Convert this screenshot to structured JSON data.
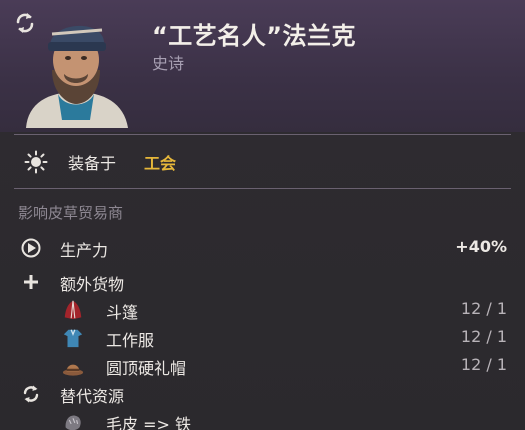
{
  "card": {
    "title": "“工艺名人”法兰克",
    "rarity": "史诗"
  },
  "equipped": {
    "label": "装备于",
    "value": "工会"
  },
  "influence_text": "影响皮草贸易商",
  "productivity": {
    "label": "生产力",
    "value": "+40%"
  },
  "extra_goods": {
    "label": "额外货物",
    "items": [
      {
        "name": "斗篷",
        "ratio": "12 / 1",
        "icon": "cloak-icon"
      },
      {
        "name": "工作服",
        "ratio": "12 / 1",
        "icon": "workwear-icon"
      },
      {
        "name": "圆顶硬礼帽",
        "ratio": "12 / 1",
        "icon": "bowler-hat-icon"
      }
    ]
  },
  "alt_resources": {
    "label": "替代资源",
    "items": [
      {
        "name": "毛皮 => 铁",
        "icon": "fur-icon"
      }
    ]
  },
  "colors": {
    "header_bg": "#3b3146",
    "body_bg": "#2c2a2e",
    "accent_gold": "#e6b73a",
    "text_main": "#ece8e4",
    "text_muted": "#8d8792"
  }
}
